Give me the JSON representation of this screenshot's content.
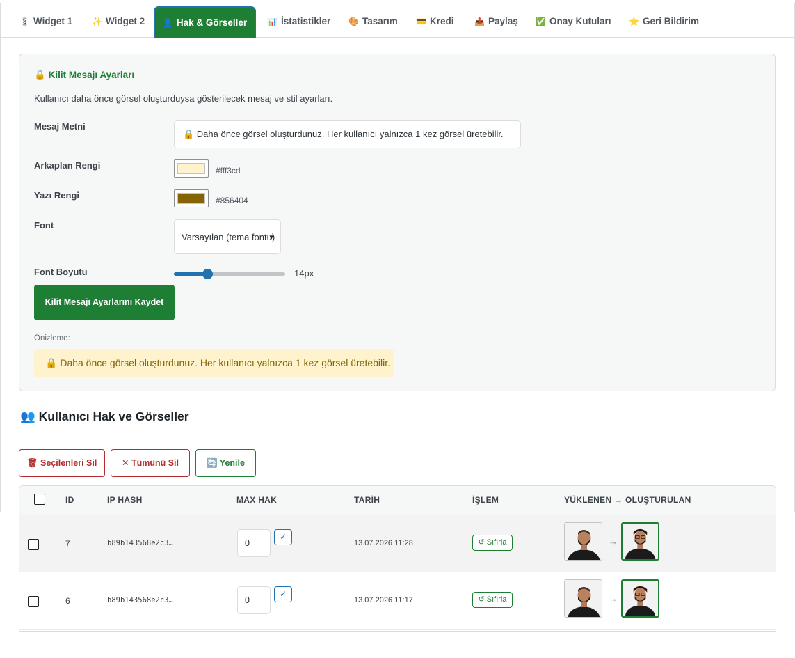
{
  "tabs": [
    {
      "icon": "💈",
      "icon_name": "barber-pole-icon",
      "label": "Widget 1"
    },
    {
      "icon": "✨",
      "icon_name": "sparkles-icon",
      "label": "Widget 2"
    },
    {
      "icon": "👤",
      "icon_name": "user-icon",
      "label": "Hak & Görseller",
      "active": true
    },
    {
      "icon": "📊",
      "icon_name": "chart-icon",
      "label": "İstatistikler"
    },
    {
      "icon": "🎨",
      "icon_name": "palette-icon",
      "label": "Tasarım"
    },
    {
      "icon": "💳",
      "icon_name": "credit-card-icon",
      "label": "Kredi"
    },
    {
      "icon": "📤",
      "icon_name": "share-icon",
      "label": "Paylaş"
    },
    {
      "icon": "✅",
      "icon_name": "checkbox-icon",
      "label": "Onay Kutuları"
    },
    {
      "icon": "⭐",
      "icon_name": "star-icon",
      "label": "Geri Bildirim"
    }
  ],
  "lock_settings": {
    "icon": "🔒",
    "title": "Kilit Mesajı Ayarları",
    "description": "Kullanıcı daha önce görsel oluşturduysa gösterilecek mesaj ve stil ayarları.",
    "message_label": "Mesaj Metni",
    "message_value": "🔒 Daha önce görsel oluşturdunuz. Her kullanıcı yalnızca 1 kez görsel üretebilir.",
    "bg_label": "Arkaplan Rengi",
    "bg_color": "#fff3cd",
    "text_color_label": "Yazı Rengi",
    "text_color": "#856404",
    "font_label": "Font",
    "font_value": "Varsayılan (tema fontu)",
    "font_size_label": "Font Boyutu",
    "font_size_value": "14px",
    "font_size_fraction": 0.3,
    "save_label": "Kilit Mesajı Ayarlarını Kaydet",
    "preview_label": "Önizleme:",
    "preview_text": "Daha önce görsel oluşturdunuz. Her kullanıcı yalnızca 1 kez görsel üretebilir."
  },
  "users": {
    "icon": "👥",
    "title": "Kullanıcı Hak ve Görseller",
    "buttons": {
      "delete_selected": "🗑 Seçilenleri Sil",
      "delete_all": "✕ Tümünü Sil",
      "refresh": "🔄 Yenile"
    },
    "columns": [
      "ID",
      "IP HASH",
      "MAX HAK",
      "TARİH",
      "İŞLEM",
      "YÜKLENEN → OLUŞTURULAN"
    ],
    "rows": [
      {
        "id": "7",
        "ip_hash": "b89b143568e2c3…",
        "max_hak": "0",
        "confirm": "✓",
        "date": "13.07.2026 11:28",
        "action": "↺ Sıfırla",
        "arrow": "→"
      },
      {
        "id": "6",
        "ip_hash": "b89b143568e2c3…",
        "max_hak": "0",
        "confirm": "✓",
        "date": "13.07.2026 11:17",
        "action": "↺ Sıfırla",
        "arrow": "→"
      }
    ]
  },
  "colors": {
    "accent_green": "#1e7e34",
    "accent_blue": "#2271b1",
    "danger_red": "#b32d2e"
  }
}
